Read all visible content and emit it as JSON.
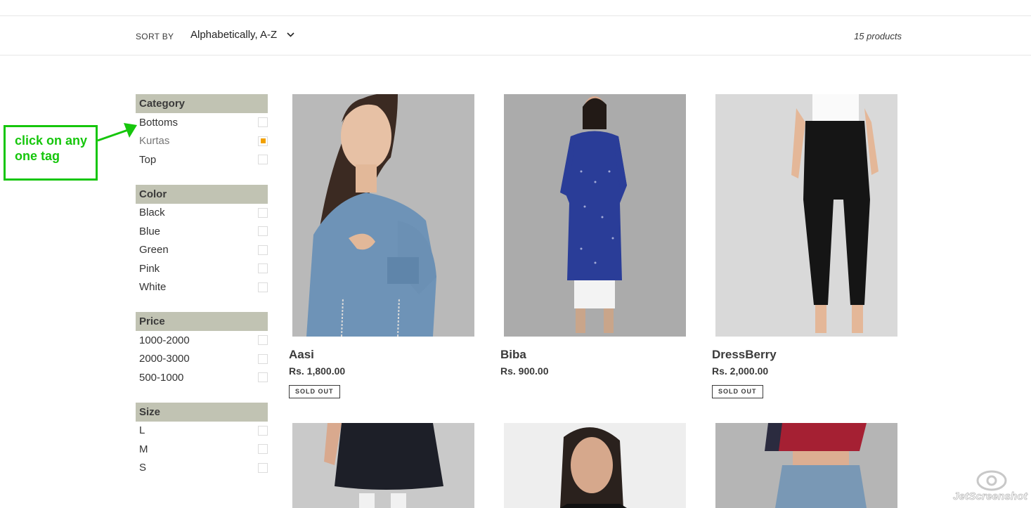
{
  "toolbar": {
    "sort_label": "SORT BY",
    "sort_value": "Alphabetically, A-Z",
    "count": "15 products"
  },
  "filters": [
    {
      "title": "Category",
      "items": [
        {
          "label": "Bottoms",
          "checked": false
        },
        {
          "label": "Kurtas",
          "checked": true
        },
        {
          "label": "Top",
          "checked": false
        }
      ]
    },
    {
      "title": "Color",
      "items": [
        {
          "label": "Black",
          "checked": false
        },
        {
          "label": "Blue",
          "checked": false
        },
        {
          "label": "Green",
          "checked": false
        },
        {
          "label": "Pink",
          "checked": false
        },
        {
          "label": "White",
          "checked": false
        }
      ]
    },
    {
      "title": "Price",
      "items": [
        {
          "label": "1000-2000",
          "checked": false
        },
        {
          "label": "2000-3000",
          "checked": false
        },
        {
          "label": "500-1000",
          "checked": false
        }
      ]
    },
    {
      "title": "Size",
      "items": [
        {
          "label": "L",
          "checked": false
        },
        {
          "label": "M",
          "checked": false
        },
        {
          "label": "S",
          "checked": false
        }
      ]
    }
  ],
  "annotation": {
    "text_line1": "click on any",
    "text_line2": "one tag",
    "color": "#16c60c"
  },
  "products": [
    {
      "name": "Aasi",
      "price": "Rs. 1,800.00",
      "badge": "SOLD OUT"
    },
    {
      "name": "Biba",
      "price": "Rs. 900.00",
      "badge": ""
    },
    {
      "name": "DressBerry",
      "price": "Rs. 2,000.00",
      "badge": "SOLD OUT"
    }
  ],
  "watermark": {
    "text": "JetScreenshot"
  },
  "colors": {
    "filter_header_bg": "#c1c3b3",
    "checked_accent": "#f2a100"
  }
}
